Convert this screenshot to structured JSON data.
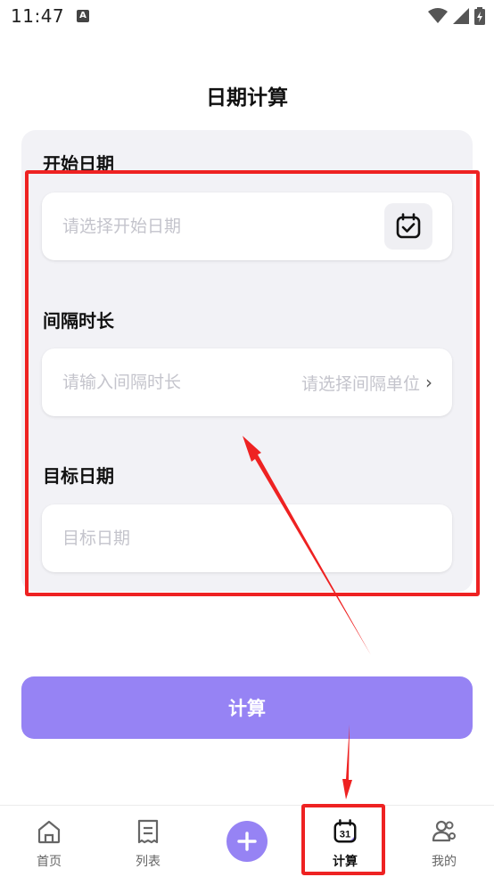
{
  "status_bar": {
    "time": "11:47",
    "notification_icon_letter": "A"
  },
  "header": {
    "title": "日期计算"
  },
  "form": {
    "start_date": {
      "label": "开始日期",
      "placeholder": "请选择开始日期",
      "icon": "calendar-check-icon"
    },
    "interval": {
      "label": "间隔时长",
      "placeholder": "请输入间隔时长",
      "unit_placeholder": "请选择间隔单位"
    },
    "target_date": {
      "label": "目标日期",
      "placeholder": "目标日期"
    }
  },
  "calculate_button": {
    "label": "计算"
  },
  "bottom_nav": {
    "items": [
      {
        "label": "首页",
        "icon": "home-icon"
      },
      {
        "label": "列表",
        "icon": "list-icon"
      },
      {
        "label": "",
        "icon": "plus-icon"
      },
      {
        "label": "计算",
        "icon": "calendar-31-icon",
        "active": true,
        "badge_text": "31"
      },
      {
        "label": "我的",
        "icon": "users-icon"
      }
    ]
  },
  "colors": {
    "accent": "#9683f4",
    "annotation_red": "#ee2222",
    "card_bg": "#f2f2f6"
  }
}
